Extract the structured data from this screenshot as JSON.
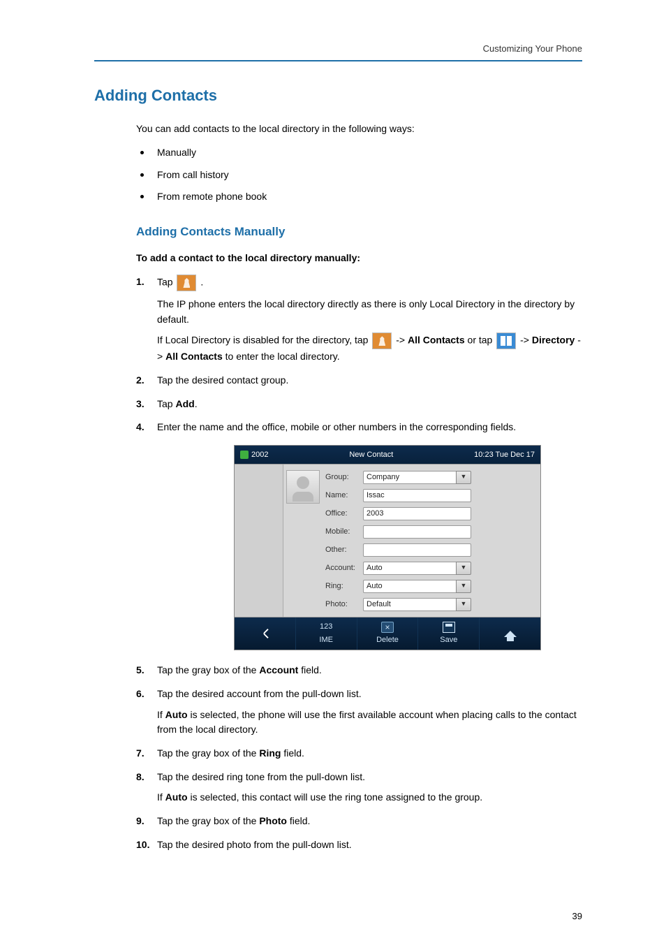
{
  "header": {
    "right_text": "Customizing Your Phone"
  },
  "h1": "Adding Contacts",
  "intro": "You can add contacts to the local directory in the following ways:",
  "bullets": [
    "Manually",
    "From call history",
    "From remote phone book"
  ],
  "h2": "Adding Contacts Manually",
  "bold_intro": "To add a contact to the local directory manually:",
  "step1": {
    "num": "1.",
    "a_prefix": "Tap ",
    "a_suffix": " .",
    "b": "The IP phone enters the local directory directly as there is only Local Directory in the directory by default.",
    "c1": "If Local Directory is disabled for the directory, tap ",
    "c2": " ->",
    "c_all_contacts": "All Contacts",
    "c3": " or tap ",
    "c4": " -> ",
    "c_directory": "Directory",
    "c5": " ->",
    "c6": " to enter the local directory."
  },
  "step2": {
    "num": "2.",
    "text": "Tap the desired contact group."
  },
  "step3": {
    "num": "3.",
    "prefix": "Tap ",
    "bold": "Add",
    "suffix": "."
  },
  "step4": {
    "num": "4.",
    "text": "Enter the name and the office, mobile or other numbers in the corresponding fields."
  },
  "phone": {
    "account": "2002",
    "title": "New Contact",
    "clock": "10:23 Tue Dec 17",
    "fields": {
      "group_label": "Group:",
      "group_value": "Company",
      "name_label": "Name:",
      "name_value": "Issac",
      "office_label": "Office:",
      "office_value": "2003",
      "mobile_label": "Mobile:",
      "mobile_value": "",
      "other_label": "Other:",
      "other_value": "",
      "account_label": "Account:",
      "account_value": "Auto",
      "ring_label": "Ring:",
      "ring_value": "Auto",
      "photo_label": "Photo:",
      "photo_value": "Default"
    },
    "footer": {
      "ime_top": "123",
      "ime_bottom": "IME",
      "delete": "Delete",
      "save": "Save"
    }
  },
  "step5": {
    "num": "5.",
    "a": "Tap the gray box of the ",
    "bold": "Account",
    "b": " field."
  },
  "step6": {
    "num": "6.",
    "a": "Tap the desired account from the pull-down list.",
    "b1": "If ",
    "b_bold": "Auto",
    "b2": " is selected, the phone will use the first available account when placing calls to the contact from the local directory."
  },
  "step7": {
    "num": "7.",
    "a": "Tap the gray box of the ",
    "bold": "Ring",
    "b": " field."
  },
  "step8": {
    "num": "8.",
    "a": "Tap the desired ring tone from the pull-down list.",
    "b1": "If ",
    "b_bold": "Auto",
    "b2": " is selected, this contact will use the ring tone assigned to the group."
  },
  "step9": {
    "num": "9.",
    "a": "Tap the gray box of the ",
    "bold": "Photo",
    "b": " field."
  },
  "step10": {
    "num": "10.",
    "a": "Tap the desired photo from the pull-down list."
  },
  "page_number": "39"
}
